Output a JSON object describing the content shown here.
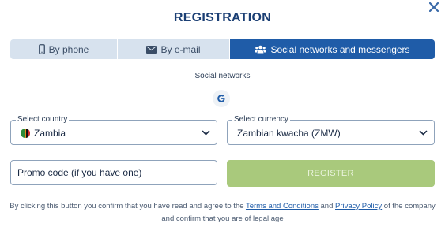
{
  "dialog": {
    "title": "REGISTRATION",
    "close_icon": "close-icon"
  },
  "tabs": [
    {
      "label": "By phone",
      "icon": "phone-icon",
      "active": false
    },
    {
      "label": "By e-mail",
      "icon": "envelope-icon",
      "active": false
    },
    {
      "label": "Social networks and messengers",
      "icon": "users-icon",
      "active": true
    }
  ],
  "social": {
    "label": "Social networks",
    "providers": [
      {
        "icon": "google-icon"
      }
    ]
  },
  "country": {
    "legend": "Select country",
    "value": "Zambia",
    "icon": "zambia-flag-icon"
  },
  "currency": {
    "legend": "Select currency",
    "value": "Zambian kwacha (ZMW)"
  },
  "promo": {
    "placeholder": "Promo code (if you have one)"
  },
  "register": {
    "label": "REGISTER"
  },
  "disclaimer": {
    "before": "By clicking this button you confirm that you have read and agree to the ",
    "terms_link": "Terms and Conditions",
    "and": " and ",
    "privacy_link": "Privacy Policy",
    "after": " of the company and confirm that you are of legal age"
  },
  "colors": {
    "title": "#1b3f74",
    "active_tab": "#1f5ca8",
    "inactive_tab": "#d7e2ee",
    "register_button": "#a9c97c",
    "link": "#1f5ca8"
  }
}
